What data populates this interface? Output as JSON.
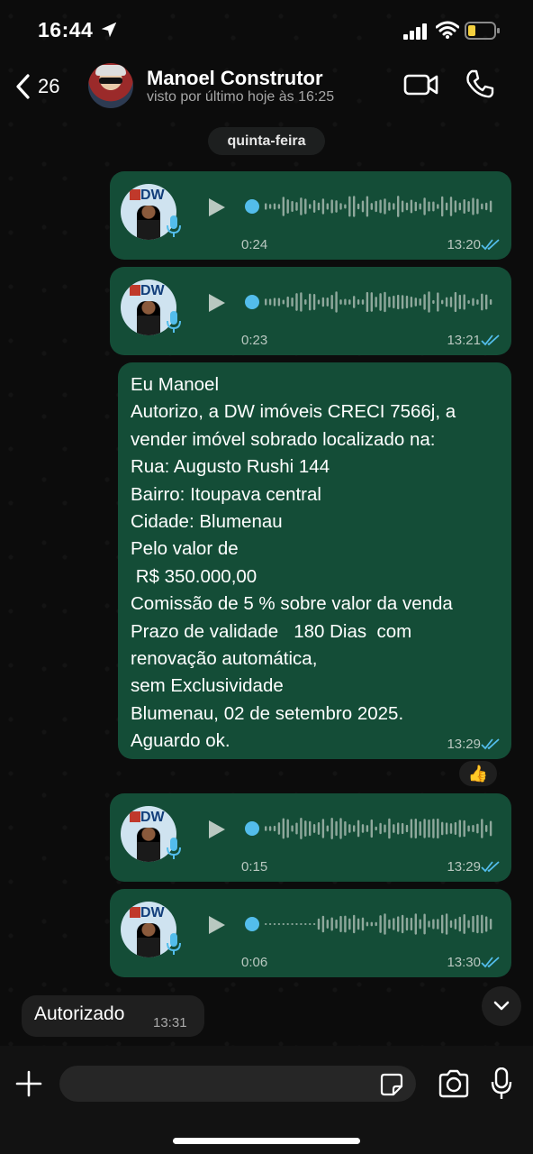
{
  "status_bar": {
    "time": "16:44"
  },
  "header": {
    "back_count": "26",
    "contact_name": "Manoel Construtor",
    "contact_status": "visto por último hoje às 16:25"
  },
  "date_separator": "quinta-feira",
  "messages": [
    {
      "type": "voice",
      "direction": "out",
      "duration": "0:24",
      "time": "13:20",
      "read": true,
      "avatar_logo": "DW"
    },
    {
      "type": "voice",
      "direction": "out",
      "duration": "0:23",
      "time": "13:21",
      "read": true,
      "avatar_logo": "DW"
    },
    {
      "type": "text",
      "direction": "out",
      "time": "13:29",
      "read": true,
      "lines": [
        "Eu Manoel",
        "Autorizo, a DW imóveis CRECI 7566j, a",
        "vender imóvel sobrado localizado na:",
        "Rua: Augusto Rushi 144",
        "Bairro: Itoupava central",
        "Cidade: Blumenau",
        "Pelo valor de",
        " R$ 350.000,00",
        "Comissão de 5 % sobre valor da venda",
        "Prazo de validade   180 Dias  com",
        "renovação automática,",
        "sem Exclusividade",
        "Blumenau, 02 de setembro 2025.",
        "Aguardo ok."
      ],
      "reaction": "👍"
    },
    {
      "type": "voice",
      "direction": "out",
      "duration": "0:15",
      "time": "13:29",
      "read": true,
      "avatar_logo": "DW"
    },
    {
      "type": "voice",
      "direction": "out",
      "duration": "0:06",
      "time": "13:30",
      "read": true,
      "avatar_logo": "DW"
    },
    {
      "type": "text",
      "direction": "in",
      "text": "Autorizado",
      "time": "13:31"
    }
  ],
  "input": {
    "placeholder": ""
  },
  "colors": {
    "outgoing_bubble": "#144d37",
    "incoming_bubble": "#1f1f1f",
    "read_tick": "#53bdeb",
    "background": "#0c0c0c"
  },
  "icons": [
    "location-arrow-icon",
    "signal-icon",
    "wifi-icon",
    "battery-icon",
    "back-chevron-icon",
    "video-camera-icon",
    "phone-icon",
    "play-icon",
    "microphone-icon",
    "double-check-icon",
    "chevron-down-icon",
    "plus-icon",
    "sticker-icon",
    "camera-icon"
  ]
}
